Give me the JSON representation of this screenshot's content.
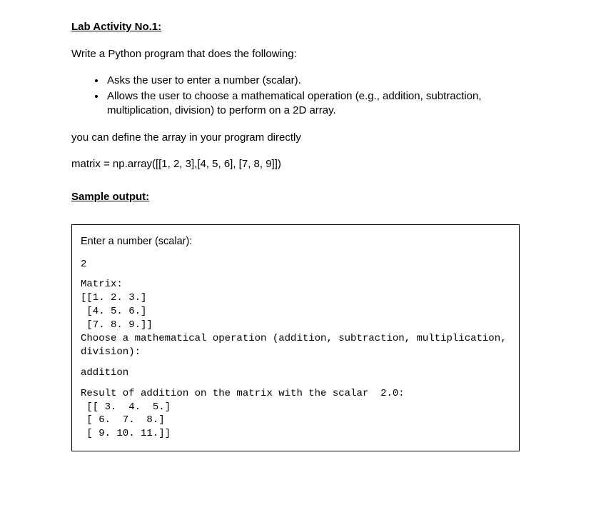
{
  "activity": {
    "title": "Lab Activity No.1:",
    "intro": "Write a Python program that does the following:",
    "bullets": [
      "Asks the user to enter a number (scalar).",
      "Allows the user to choose a mathematical operation (e.g., addition, subtraction, multiplication, division) to perform on a 2D array."
    ],
    "note": "you can define the array in your program directly",
    "matrix_def": "matrix = np.array([[1, 2, 3],[4, 5, 6], [7, 8, 9]])",
    "sample_output_title": "Sample output:"
  },
  "output": {
    "prompt_scalar": "Enter a number (scalar):",
    "scalar_value": "2",
    "matrix_label_and_data": "Matrix:\n[[1. 2. 3.]\n [4. 5. 6.]\n [7. 8. 9.]]\nChoose a mathematical operation (addition, subtraction, multiplication,\ndivision):",
    "operation_input": "addition",
    "result_text": "Result of addition on the matrix with the scalar  2.0:\n [[ 3.  4.  5.]\n [ 6.  7.  8.]\n [ 9. 10. 11.]]"
  }
}
